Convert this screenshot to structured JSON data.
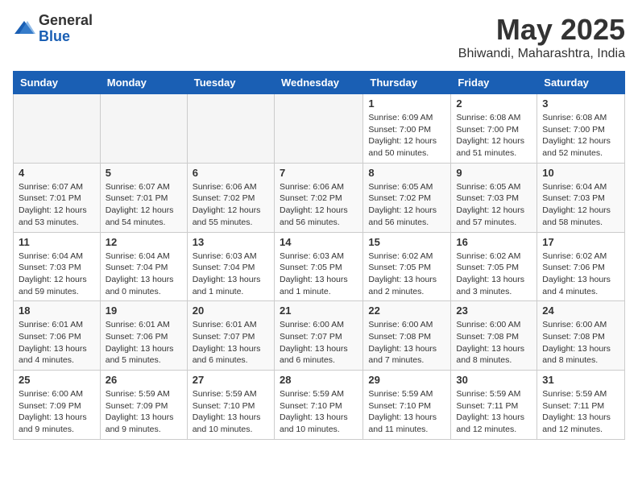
{
  "header": {
    "logo_general": "General",
    "logo_blue": "Blue",
    "month_title": "May 2025",
    "location": "Bhiwandi, Maharashtra, India"
  },
  "weekdays": [
    "Sunday",
    "Monday",
    "Tuesday",
    "Wednesday",
    "Thursday",
    "Friday",
    "Saturday"
  ],
  "weeks": [
    [
      {
        "day": "",
        "info": ""
      },
      {
        "day": "",
        "info": ""
      },
      {
        "day": "",
        "info": ""
      },
      {
        "day": "",
        "info": ""
      },
      {
        "day": "1",
        "info": "Sunrise: 6:09 AM\nSunset: 7:00 PM\nDaylight: 12 hours\nand 50 minutes."
      },
      {
        "day": "2",
        "info": "Sunrise: 6:08 AM\nSunset: 7:00 PM\nDaylight: 12 hours\nand 51 minutes."
      },
      {
        "day": "3",
        "info": "Sunrise: 6:08 AM\nSunset: 7:00 PM\nDaylight: 12 hours\nand 52 minutes."
      }
    ],
    [
      {
        "day": "4",
        "info": "Sunrise: 6:07 AM\nSunset: 7:01 PM\nDaylight: 12 hours\nand 53 minutes."
      },
      {
        "day": "5",
        "info": "Sunrise: 6:07 AM\nSunset: 7:01 PM\nDaylight: 12 hours\nand 54 minutes."
      },
      {
        "day": "6",
        "info": "Sunrise: 6:06 AM\nSunset: 7:02 PM\nDaylight: 12 hours\nand 55 minutes."
      },
      {
        "day": "7",
        "info": "Sunrise: 6:06 AM\nSunset: 7:02 PM\nDaylight: 12 hours\nand 56 minutes."
      },
      {
        "day": "8",
        "info": "Sunrise: 6:05 AM\nSunset: 7:02 PM\nDaylight: 12 hours\nand 56 minutes."
      },
      {
        "day": "9",
        "info": "Sunrise: 6:05 AM\nSunset: 7:03 PM\nDaylight: 12 hours\nand 57 minutes."
      },
      {
        "day": "10",
        "info": "Sunrise: 6:04 AM\nSunset: 7:03 PM\nDaylight: 12 hours\nand 58 minutes."
      }
    ],
    [
      {
        "day": "11",
        "info": "Sunrise: 6:04 AM\nSunset: 7:03 PM\nDaylight: 12 hours\nand 59 minutes."
      },
      {
        "day": "12",
        "info": "Sunrise: 6:04 AM\nSunset: 7:04 PM\nDaylight: 13 hours\nand 0 minutes."
      },
      {
        "day": "13",
        "info": "Sunrise: 6:03 AM\nSunset: 7:04 PM\nDaylight: 13 hours\nand 1 minute."
      },
      {
        "day": "14",
        "info": "Sunrise: 6:03 AM\nSunset: 7:05 PM\nDaylight: 13 hours\nand 1 minute."
      },
      {
        "day": "15",
        "info": "Sunrise: 6:02 AM\nSunset: 7:05 PM\nDaylight: 13 hours\nand 2 minutes."
      },
      {
        "day": "16",
        "info": "Sunrise: 6:02 AM\nSunset: 7:05 PM\nDaylight: 13 hours\nand 3 minutes."
      },
      {
        "day": "17",
        "info": "Sunrise: 6:02 AM\nSunset: 7:06 PM\nDaylight: 13 hours\nand 4 minutes."
      }
    ],
    [
      {
        "day": "18",
        "info": "Sunrise: 6:01 AM\nSunset: 7:06 PM\nDaylight: 13 hours\nand 4 minutes."
      },
      {
        "day": "19",
        "info": "Sunrise: 6:01 AM\nSunset: 7:06 PM\nDaylight: 13 hours\nand 5 minutes."
      },
      {
        "day": "20",
        "info": "Sunrise: 6:01 AM\nSunset: 7:07 PM\nDaylight: 13 hours\nand 6 minutes."
      },
      {
        "day": "21",
        "info": "Sunrise: 6:00 AM\nSunset: 7:07 PM\nDaylight: 13 hours\nand 6 minutes."
      },
      {
        "day": "22",
        "info": "Sunrise: 6:00 AM\nSunset: 7:08 PM\nDaylight: 13 hours\nand 7 minutes."
      },
      {
        "day": "23",
        "info": "Sunrise: 6:00 AM\nSunset: 7:08 PM\nDaylight: 13 hours\nand 8 minutes."
      },
      {
        "day": "24",
        "info": "Sunrise: 6:00 AM\nSunset: 7:08 PM\nDaylight: 13 hours\nand 8 minutes."
      }
    ],
    [
      {
        "day": "25",
        "info": "Sunrise: 6:00 AM\nSunset: 7:09 PM\nDaylight: 13 hours\nand 9 minutes."
      },
      {
        "day": "26",
        "info": "Sunrise: 5:59 AM\nSunset: 7:09 PM\nDaylight: 13 hours\nand 9 minutes."
      },
      {
        "day": "27",
        "info": "Sunrise: 5:59 AM\nSunset: 7:10 PM\nDaylight: 13 hours\nand 10 minutes."
      },
      {
        "day": "28",
        "info": "Sunrise: 5:59 AM\nSunset: 7:10 PM\nDaylight: 13 hours\nand 10 minutes."
      },
      {
        "day": "29",
        "info": "Sunrise: 5:59 AM\nSunset: 7:10 PM\nDaylight: 13 hours\nand 11 minutes."
      },
      {
        "day": "30",
        "info": "Sunrise: 5:59 AM\nSunset: 7:11 PM\nDaylight: 13 hours\nand 12 minutes."
      },
      {
        "day": "31",
        "info": "Sunrise: 5:59 AM\nSunset: 7:11 PM\nDaylight: 13 hours\nand 12 minutes."
      }
    ]
  ]
}
